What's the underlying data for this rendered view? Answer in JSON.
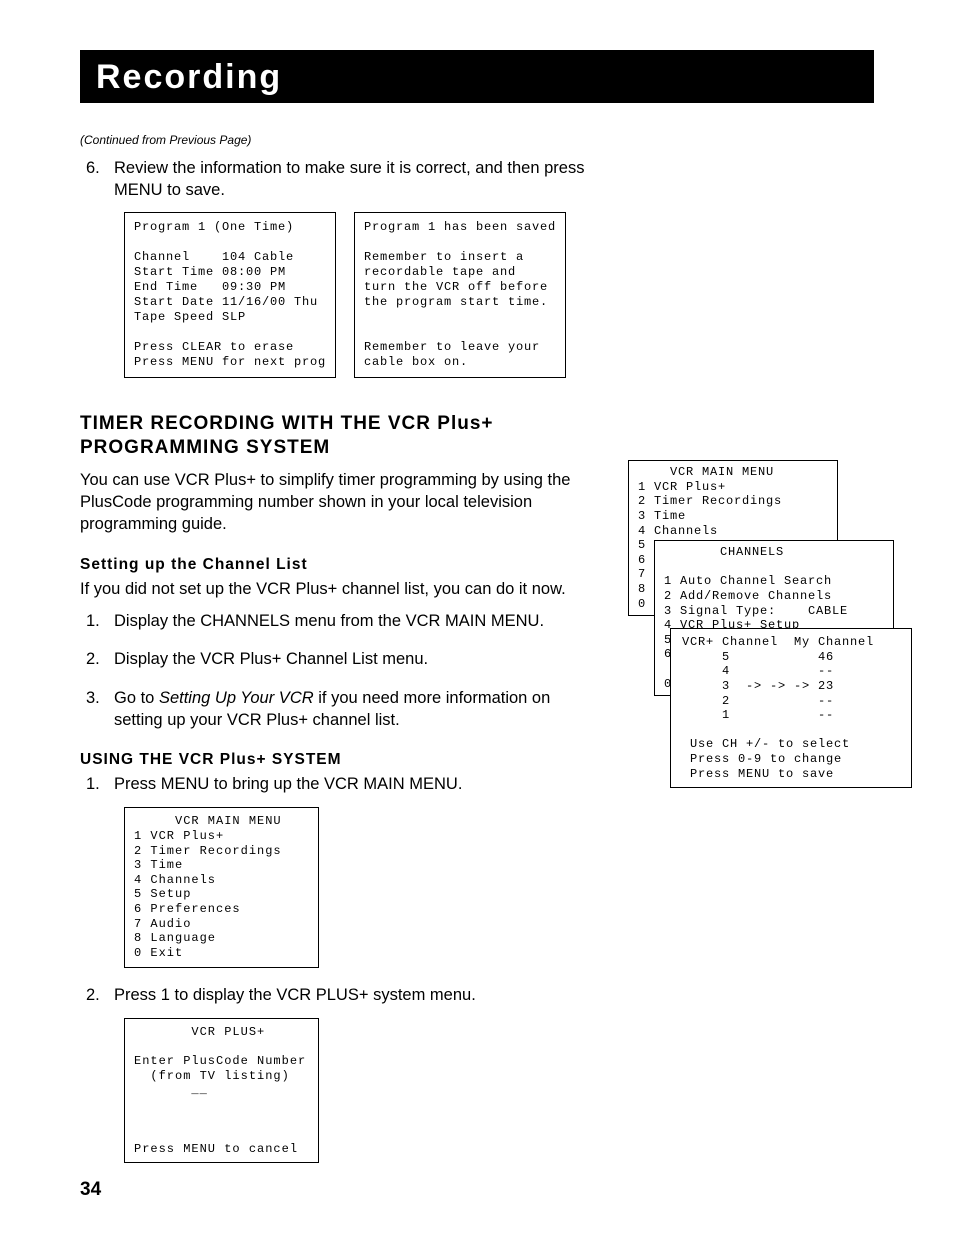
{
  "header": {
    "title": "Recording"
  },
  "continued": "(Continued from Previous Page)",
  "step6": {
    "num": "6.",
    "text": "Review the information to make sure it is correct, and then press MENU to save."
  },
  "screen_prog1": "Program 1 (One Time)\n\nChannel    104 Cable\nStart Time 08:00 PM\nEnd Time   09:30 PM\nStart Date 11/16/00 Thu\nTape Speed SLP\n\nPress CLEAR to erase\nPress MENU for next prog",
  "screen_saved": "Program 1 has been saved\n\nRemember to insert a\nrecordable tape and\nturn the VCR off before\nthe program start time.\n\n\nRemember to leave your\ncable box on.",
  "h2_timer": "TIMER RECORDING WITH THE VCR Plus+ PROGRAMMING SYSTEM",
  "para_timer": "You can use VCR Plus+ to simplify timer programming by using the PlusCode programming number shown in your local television programming guide.",
  "h3_setup": "Setting up the Channel List",
  "para_setup": "If you did not set up the VCR Plus+ channel list, you can do it now.",
  "setup_steps": {
    "1": {
      "num": "1.",
      "text": "Display the CHANNELS menu from the VCR MAIN MENU."
    },
    "2": {
      "num": "2.",
      "text": "Display the VCR Plus+ Channel List menu."
    },
    "3": {
      "num": "3.",
      "pre": "Go to ",
      "it": "Setting Up Your VCR",
      "post": " if you need more information on setting up your VCR Plus+ channel list."
    }
  },
  "h3_using": "USING THE VCR Plus+ SYSTEM",
  "using_steps": {
    "1": {
      "num": "1.",
      "text": "Press MENU to bring up the VCR MAIN MENU."
    },
    "2": {
      "num": "2.",
      "text": "Press 1 to display the VCR PLUS+ system menu."
    }
  },
  "screen_mainmenu": "     VCR MAIN MENU\n1 VCR Plus+\n2 Timer Recordings\n3 Time\n4 Channels\n5 Setup\n6 Preferences\n7 Audio\n8 Language\n0 Exit",
  "screen_vcrplus": "       VCR PLUS+\n\nEnter PlusCode Number\n  (from TV listing)\n       __\n\n\n\nPress MENU to cancel",
  "right": {
    "box1": "    VCR MAIN MENU\n1 VCR Plus+\n2 Timer Recordings\n3 Time\n4 Channels\n5\n6\n7\n8\n0",
    "box2": "       CHANNELS\n\n1 Auto Channel Search\n2 Add/Remove Channels\n3 Signal Type:    CABLE\n4 VCR Plus+ Setup\n5\n6\n\n0",
    "box3": "VCR+ Channel  My Channel\n     5           46\n     4           --\n     3  -> -> -> 23\n     2           --\n     1           --\n\n Use CH +/- to select\n Press 0-9 to change\n Press MENU to save"
  },
  "page_num": "34"
}
